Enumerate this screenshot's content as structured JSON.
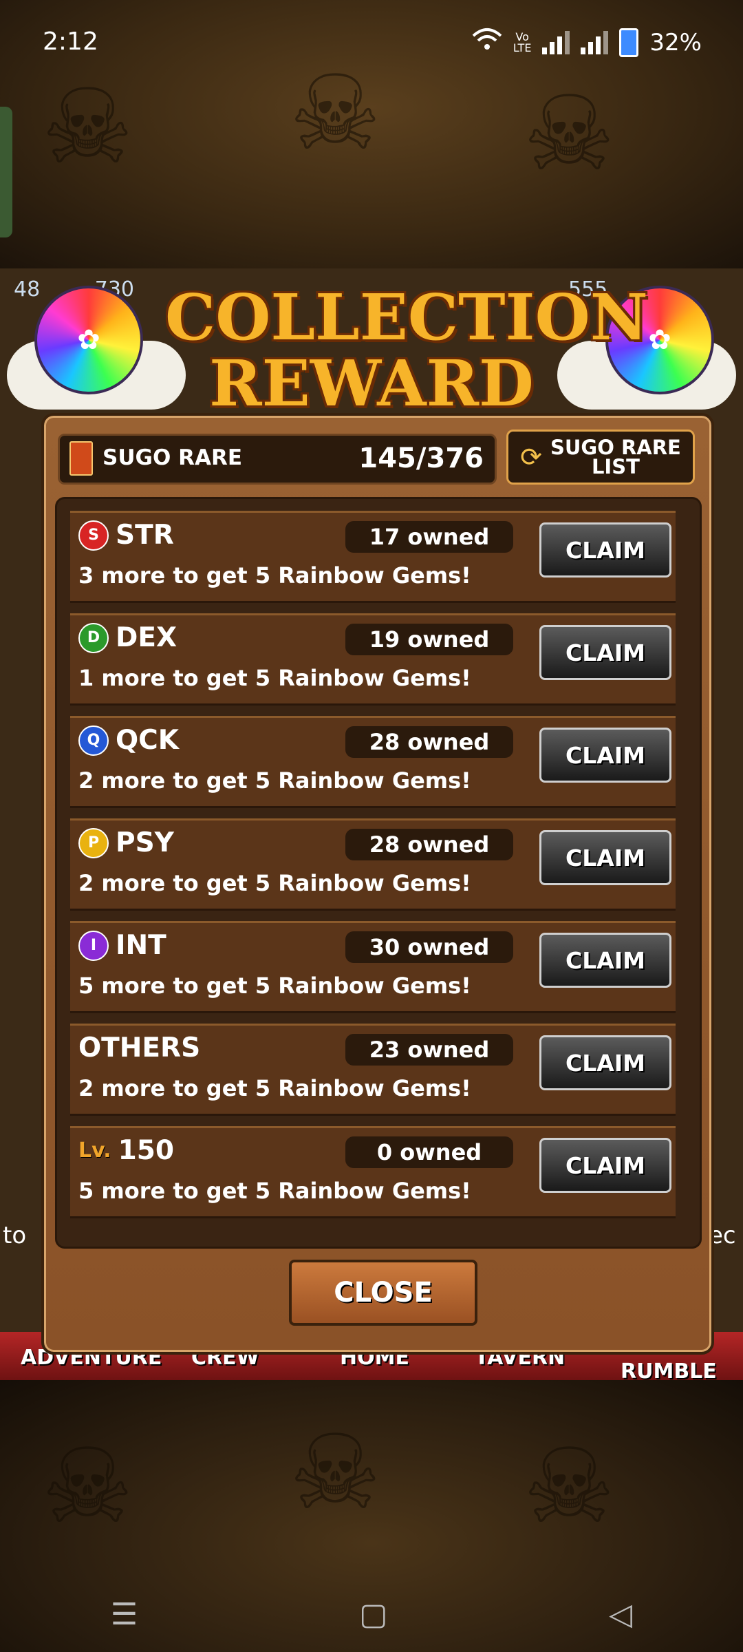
{
  "status_bar": {
    "time": "2:12",
    "volte_top": "Vo",
    "volte_bottom": "LTE",
    "battery": "32%"
  },
  "background": {
    "left_edge_text": "to",
    "right_edge_text": "ec",
    "top_left_number": "48",
    "top_left_number2": "730",
    "top_right_number": "555"
  },
  "modal": {
    "title_line1": "COLLECTION",
    "title_line2": "REWARD",
    "counter": {
      "label": "SUGO RARE",
      "value": "145/376"
    },
    "list_button": {
      "line1": "SUGO RARE",
      "line2": "LIST"
    },
    "rows": [
      {
        "badge": "S",
        "name": "STR",
        "color": "#d82424",
        "owned": "17 owned",
        "message": "3 more to get 5 Rainbow Gems!",
        "claim": "CLAIM"
      },
      {
        "badge": "D",
        "name": "DEX",
        "color": "#2b9a2b",
        "owned": "19 owned",
        "message": "1 more to get 5 Rainbow Gems!",
        "claim": "CLAIM"
      },
      {
        "badge": "Q",
        "name": "QCK",
        "color": "#2458d6",
        "owned": "28 owned",
        "message": "2 more to get 5 Rainbow Gems!",
        "claim": "CLAIM"
      },
      {
        "badge": "P",
        "name": "PSY",
        "color": "#e9b210",
        "owned": "28 owned",
        "message": "2 more to get 5 Rainbow Gems!",
        "claim": "CLAIM"
      },
      {
        "badge": "I",
        "name": "INT",
        "color": "#8a2bd6",
        "owned": "30 owned",
        "message": "5 more to get 5 Rainbow Gems!",
        "claim": "CLAIM"
      },
      {
        "badge": "",
        "name": "OTHERS",
        "color": "",
        "owned": "23 owned",
        "message": "2 more to get 5 Rainbow Gems!",
        "claim": "CLAIM"
      },
      {
        "badge": "Lv.",
        "name": "150",
        "color": "#f2a52a",
        "owned": "0 owned",
        "message": "5 more to get 5 Rainbow Gems!",
        "claim": "CLAIM"
      }
    ],
    "close_label": "CLOSE"
  },
  "bottom_menu": [
    "ADVENTURE",
    "CREW",
    "HOME",
    "TAVERN",
    "RUMBLE"
  ],
  "icons": {
    "refresh": "refresh-icon",
    "card": "sugo-card-icon",
    "fruit": "rainbow-fruit-icon",
    "nav_menu": "menu-icon",
    "nav_home": "home-square-icon",
    "nav_back": "back-triangle-icon"
  }
}
